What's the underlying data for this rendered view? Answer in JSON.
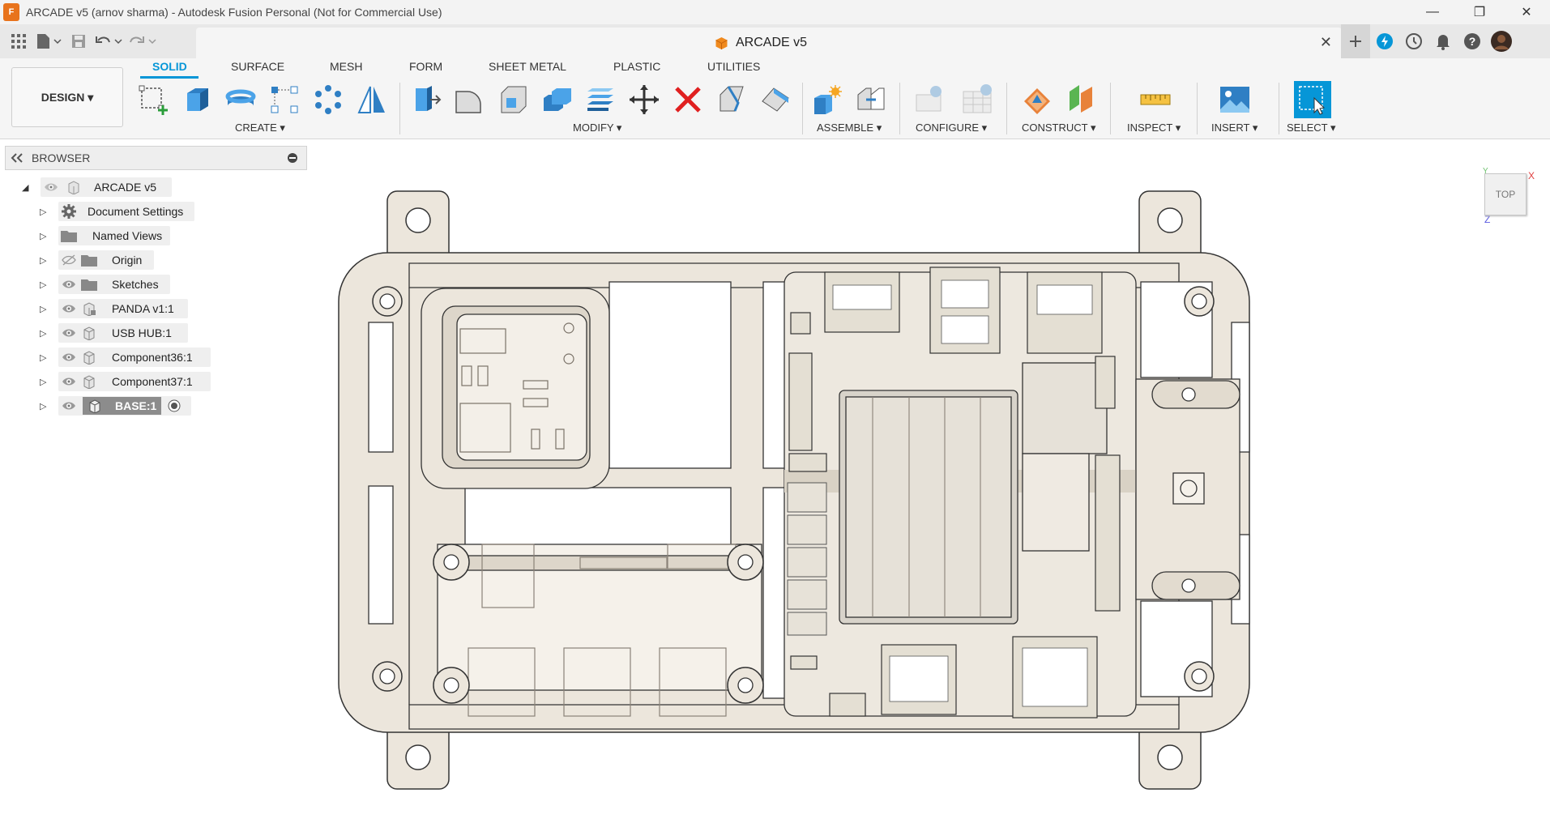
{
  "window": {
    "title": "ARCADE v5 (arnov sharma) - Autodesk Fusion Personal (Not for Commercial Use)",
    "app_logo": "F",
    "controls": [
      "—",
      "❐",
      "✕"
    ]
  },
  "document_tab": {
    "label": "ARCADE v5",
    "close": "✕"
  },
  "ribbon": {
    "workspace": "DESIGN ▾",
    "tabs": [
      "SOLID",
      "SURFACE",
      "MESH",
      "FORM",
      "SHEET METAL",
      "PLASTIC",
      "UTILITIES"
    ],
    "active_tab": "SOLID",
    "groups": [
      "CREATE ▾",
      "MODIFY ▾",
      "ASSEMBLE ▾",
      "CONFIGURE ▾",
      "CONSTRUCT ▾",
      "INSPECT ▾",
      "INSERT ▾",
      "SELECT ▾"
    ]
  },
  "browser": {
    "title": "BROWSER",
    "root": "ARCADE v5",
    "items": [
      {
        "label": "Document Settings",
        "icon": "gear-icon"
      },
      {
        "label": "Named Views",
        "icon": "folder-icon"
      },
      {
        "label": "Origin",
        "icon": "folder-icon",
        "hidden": true
      },
      {
        "label": "Sketches",
        "icon": "folder-icon"
      },
      {
        "label": "PANDA v1:1",
        "icon": "component-linked-icon"
      },
      {
        "label": "USB HUB:1",
        "icon": "component-icon"
      },
      {
        "label": "Component36:1",
        "icon": "component-icon"
      },
      {
        "label": "Component37:1",
        "icon": "component-icon"
      },
      {
        "label": "BASE:1",
        "icon": "component-icon",
        "active": true
      }
    ]
  },
  "viewcube": {
    "face": "TOP",
    "axis_x": "X",
    "axis_y": "Y",
    "axis_z": "Z"
  },
  "colors": {
    "accent": "#0696d7",
    "part_fill": "#ece6dc",
    "part_stroke": "#2a2a2a"
  }
}
